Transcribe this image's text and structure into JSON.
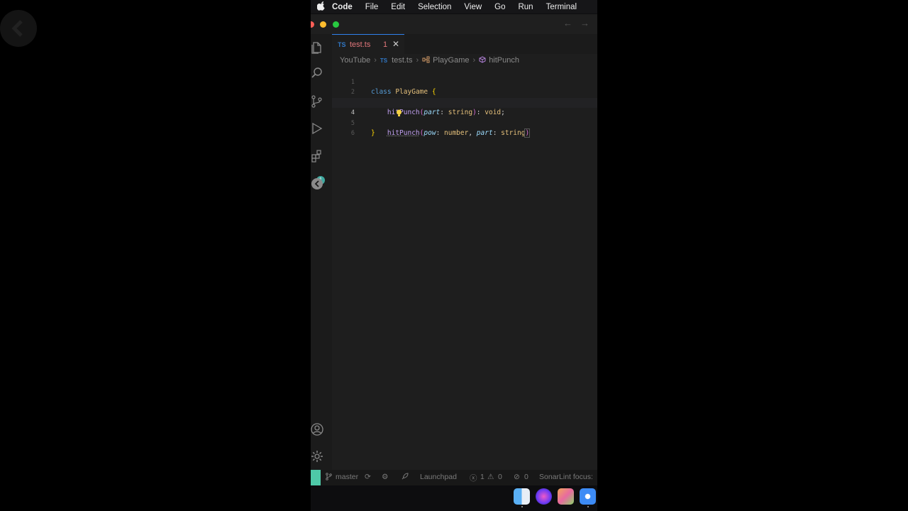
{
  "menubar": {
    "app_name": "Code",
    "items": [
      "File",
      "Edit",
      "Selection",
      "View",
      "Go",
      "Run",
      "Terminal"
    ]
  },
  "tab": {
    "lang_badge": "TS",
    "filename": "test.ts",
    "problem_count": "1",
    "close_glyph": "✕"
  },
  "breadcrumb": {
    "folder": "YouTube",
    "lang_badge": "TS",
    "file": "test.ts",
    "class": "PlayGame",
    "method": "hitPunch"
  },
  "editor": {
    "line_numbers": [
      "1",
      "2",
      "3",
      "4",
      "5",
      "6"
    ],
    "current_line": "4"
  },
  "statusbar": {
    "branch": "master",
    "launchpad": "Launchpad",
    "errors": "1",
    "warnings": "0",
    "info": "0",
    "sonarlint": "SonarLint focus:"
  },
  "activity_icons": [
    "explorer-icon",
    "search-icon",
    "source-control-icon",
    "run-debug-icon",
    "extensions-icon",
    "remote-icon",
    "account-icon",
    "settings-icon"
  ],
  "extensions_badge": "1",
  "colors": {
    "accent_tab": "#2f80ed",
    "error_text": "#e0767a",
    "remote_indicator": "#4ec9a8",
    "badge": "#3fa9a0"
  }
}
